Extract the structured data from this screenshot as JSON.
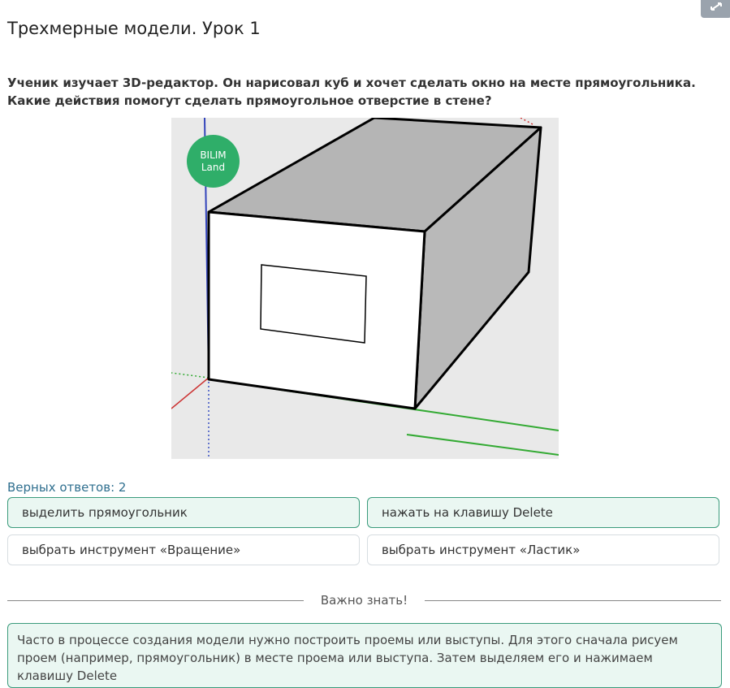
{
  "header": {
    "title": "Трехмерные модели. Урок 1",
    "expand_icon": "expand-icon"
  },
  "question": {
    "text": "Ученик изучает 3D-редактор. Он нарисовал куб и хочет сделать окно на месте прямоугольника. Какие действия помогут сделать прямоугольное отверстие в стене?"
  },
  "figure": {
    "logo_line1": "BILIM",
    "logo_line2": "Land"
  },
  "answers": {
    "correct_count": "Верных ответов: 2",
    "options": [
      {
        "label": "выделить прямоугольник",
        "selected": true
      },
      {
        "label": "нажать на клавишу Delete",
        "selected": true
      },
      {
        "label": "выбрать инструмент «Вращение»",
        "selected": false
      },
      {
        "label": "выбрать инструмент «Ластик»",
        "selected": false
      }
    ]
  },
  "important": {
    "label": "Важно знать!",
    "text": "Часто в процессе создания модели нужно построить проемы или выступы. Для этого сначала рисуем проем (например, прямоугольник) в месте проема или выступа. Затем выделяем его и нажимаем клавишу Delete"
  },
  "colors": {
    "accent": "#3a9b7c",
    "selected_bg": "#eaf7f2",
    "logo": "#2fae69"
  }
}
